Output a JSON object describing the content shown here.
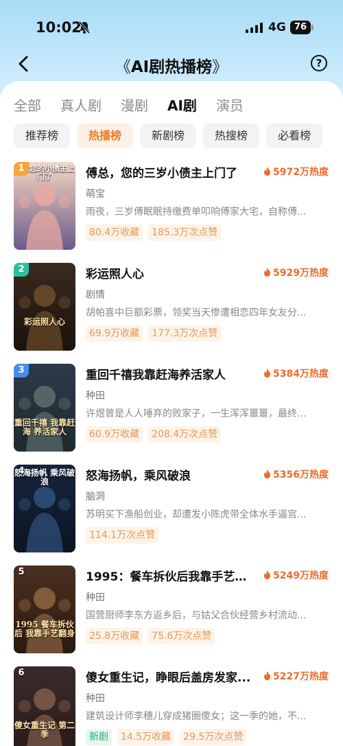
{
  "status_bar": {
    "time": "10:02",
    "network": "4G",
    "battery": "76"
  },
  "header": {
    "title": "AI剧热播榜",
    "title_left_deco": "《",
    "title_right_deco": "》",
    "help_label": "?"
  },
  "category_tabs": [
    {
      "label": "全部",
      "active": false
    },
    {
      "label": "真人剧",
      "active": false
    },
    {
      "label": "漫剧",
      "active": false
    },
    {
      "label": "AI剧",
      "active": true
    },
    {
      "label": "演员",
      "active": false
    }
  ],
  "rank_tabs": [
    {
      "label": "推荐榜",
      "active": false
    },
    {
      "label": "热播榜",
      "active": true
    },
    {
      "label": "新剧榜",
      "active": false
    },
    {
      "label": "热搜榜",
      "active": false
    },
    {
      "label": "必看榜",
      "active": false
    }
  ],
  "colors": {
    "accent": "#f07a28",
    "heat": "#ee6b2b",
    "badge_1": "#f5a53c",
    "badge_2": "#2bbf9c",
    "badge_3": "#4a8cf0",
    "badge_default": "#9a9a9a"
  },
  "dramas": [
    {
      "rank": "1",
      "title": "傅总，您的三岁小债主上门了",
      "heat": "5972万热度",
      "genre": "萌宝",
      "desc": "雨夜，三岁傅眠眠持缴费单叩响傅家大宅，自称傅...",
      "cover_caption": "傅总您的小债主上门了",
      "stats": [
        {
          "text": "80.4万收藏"
        },
        {
          "text": "185.3万次点赞"
        }
      ]
    },
    {
      "rank": "2",
      "title": "彩运照人心",
      "heat": "5929万热度",
      "genre": "剧情",
      "desc": "胡帕喜中巨额彩票，领奖当天惨遭相恋四年女友分...",
      "cover_caption": "彩运照人心",
      "stats": [
        {
          "text": "69.9万收藏"
        },
        {
          "text": "177.3万次点赞"
        }
      ]
    },
    {
      "rank": "3",
      "title": "重回千禧我靠赶海养活家人",
      "heat": "5384万热度",
      "genre": "种田",
      "desc": "许煜曾是人人唾弃的败家子，一生浑浑噩噩，最终...",
      "cover_caption": "重回千禧 我靠赶海 养活家人",
      "stats": [
        {
          "text": "60.9万收藏"
        },
        {
          "text": "208.4万次点赞"
        }
      ]
    },
    {
      "rank": "4",
      "title": "怒海扬帆，乘风破浪",
      "heat": "5356万热度",
      "genre": "脑洞",
      "desc": "苏明买下渔船创业，却遭发小陈虎带全体水手逼宫...",
      "cover_caption": "怒海扬帆 乘风破浪",
      "stats": [
        {
          "text": "114.1万次点赞"
        }
      ]
    },
    {
      "rank": "5",
      "title": "1995：餐车拆伙后我靠手艺翻身",
      "heat": "5249万热度",
      "genre": "种田",
      "desc": "国营厨师李东方返乡后，与姑父合伙经营乡村流动...",
      "cover_caption": "1995 餐车拆伙后 我靠手艺翻身",
      "stats": [
        {
          "text": "25.8万收藏"
        },
        {
          "text": "75.6万次点赞"
        }
      ]
    },
    {
      "rank": "6",
      "title": "傻女重生记，睁眼后盖房发家...",
      "heat": "5227万热度",
      "genre": "种田",
      "desc": "建筑设计师李穗儿穿成猪圈傻女；这一季的她，不...",
      "cover_caption": "傻女重生记 第二季",
      "stats": [
        {
          "text": "新剧",
          "new": true
        },
        {
          "text": "14.5万收藏"
        },
        {
          "text": "29.5万次点赞"
        }
      ]
    }
  ]
}
